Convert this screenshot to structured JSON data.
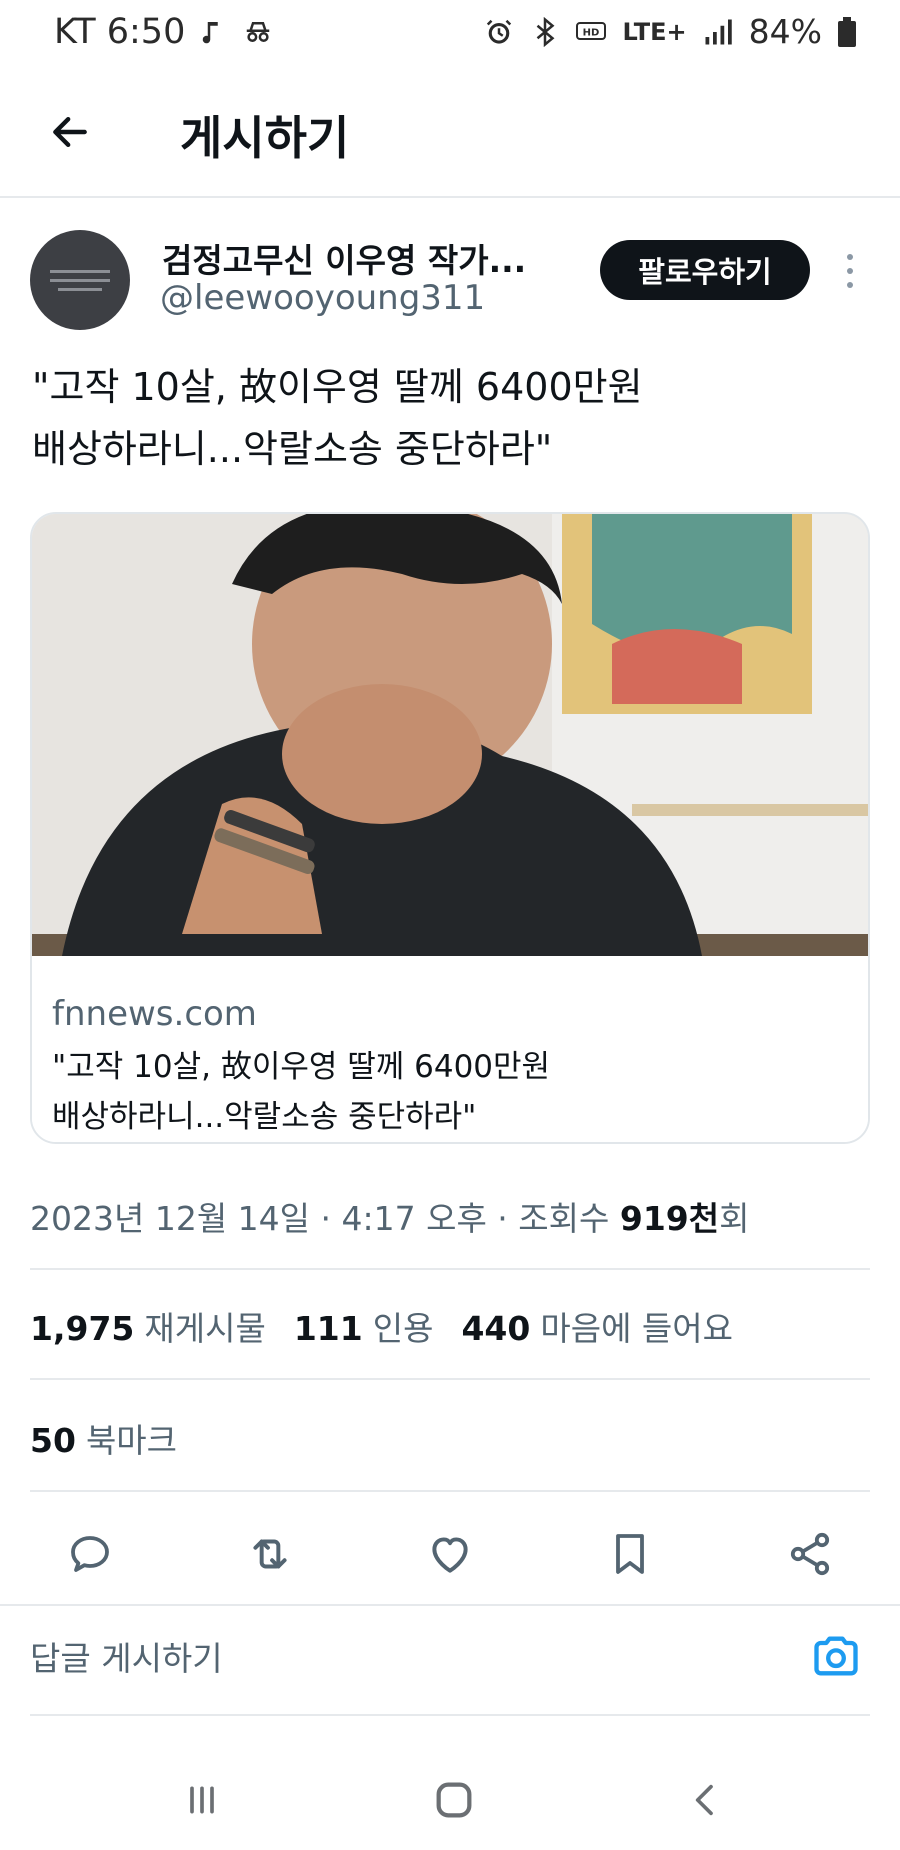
{
  "status_bar": {
    "carrier_time": "KT 6:50",
    "network": "LTE+",
    "battery": "84%"
  },
  "header": {
    "title": "게시하기"
  },
  "author": {
    "name": "검정고무신 이우영 작가...",
    "handle": "@leewooyoung311",
    "follow_label": "팔로우하기"
  },
  "tweet": {
    "text": "\"고작 10살, 故이우영 딸께 6400만원\n배상하라니...악랄소송 중단하라\""
  },
  "card": {
    "domain": "fnnews.com",
    "title": "\"고작 10살, 故이우영 딸께 6400만원\n배상하라니...악랄소송 중단하라\""
  },
  "meta": {
    "date_time": "2023년 12월 14일 · 4:17 오후 · 조회수 ",
    "views": "919천",
    "views_suffix": "회"
  },
  "stats": {
    "reposts_count": "1,975",
    "reposts_label": "재게시물",
    "quotes_count": "111",
    "quotes_label": "인용",
    "likes_count": "440",
    "likes_label": "마음에 들어요",
    "bookmarks_count": "50",
    "bookmarks_label": "북마크"
  },
  "reply": {
    "placeholder": "답글 게시하기"
  },
  "icons": {
    "back": "arrow-left-icon",
    "reply": "comment-icon",
    "repost": "repost-icon",
    "like": "heart-icon",
    "bookmark": "bookmark-icon",
    "share": "share-icon",
    "camera": "camera-icon"
  },
  "colors": {
    "text_primary": "#0f1419",
    "text_secondary": "#536471",
    "accent": "#1d9bf0",
    "follow_bg": "#0f1419"
  }
}
